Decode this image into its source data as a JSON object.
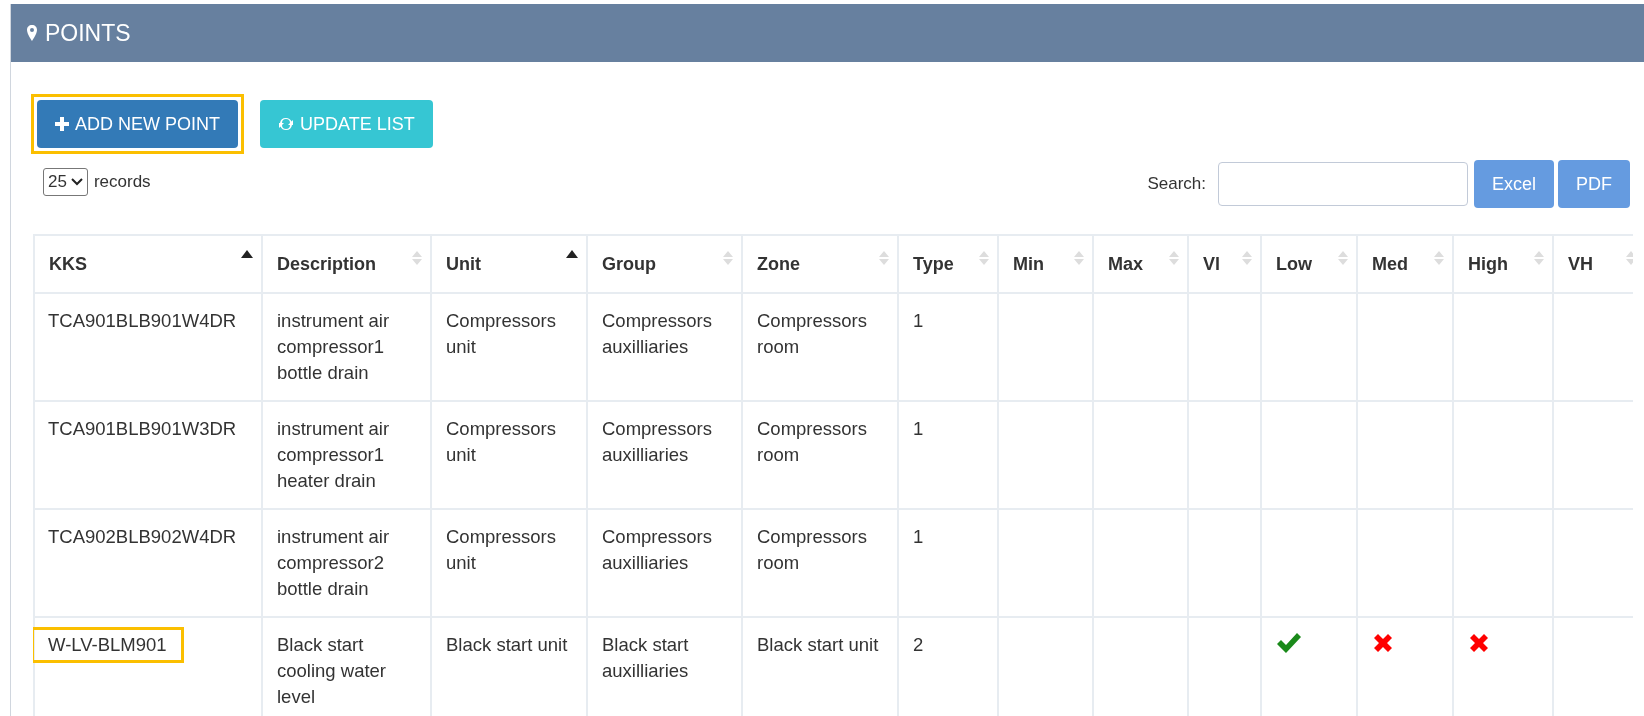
{
  "panel": {
    "title": "POINTS"
  },
  "buttons": [
    {
      "label": "ADD NEW POINT",
      "kind": "add",
      "highlighted": true
    },
    {
      "label": "UPDATE LIST",
      "kind": "refresh",
      "highlighted": false
    }
  ],
  "page_size": {
    "value": "25",
    "label": "records"
  },
  "search": {
    "label": "Search:"
  },
  "exports": [
    "Excel",
    "PDF"
  ],
  "table": {
    "columns": [
      {
        "label": "KKS",
        "sorted": true
      },
      {
        "label": "Description",
        "sorted": false
      },
      {
        "label": "Unit",
        "sorted": true
      },
      {
        "label": "Group",
        "sorted": false
      },
      {
        "label": "Zone",
        "sorted": false
      },
      {
        "label": "Type",
        "sorted": false
      },
      {
        "label": "Min",
        "sorted": false
      },
      {
        "label": "Max",
        "sorted": false
      },
      {
        "label": "Vl",
        "sorted": false
      },
      {
        "label": "Low",
        "sorted": false
      },
      {
        "label": "Med",
        "sorted": false
      },
      {
        "label": "High",
        "sorted": false
      },
      {
        "label": "VH",
        "sorted": false
      }
    ],
    "rows": [
      {
        "highlighted": false,
        "cells": [
          {
            "text": "TCA901BLB901W4DR"
          },
          {
            "text": "instrument air compressor1 bottle drain"
          },
          {
            "text": "Compressors unit"
          },
          {
            "text": "Compressors auxilliaries"
          },
          {
            "text": "Compressors room"
          },
          {
            "text": "1"
          },
          {},
          {},
          {},
          {},
          {},
          {},
          {}
        ]
      },
      {
        "highlighted": false,
        "cells": [
          {
            "text": "TCA901BLB901W3DR"
          },
          {
            "text": "instrument air compressor1 heater drain"
          },
          {
            "text": "Compressors unit"
          },
          {
            "text": "Compressors auxilliaries"
          },
          {
            "text": "Compressors room"
          },
          {
            "text": "1"
          },
          {},
          {},
          {},
          {},
          {},
          {},
          {}
        ]
      },
      {
        "highlighted": false,
        "cells": [
          {
            "text": "TCA902BLB902W4DR"
          },
          {
            "text": "instrument air compressor2 bottle drain"
          },
          {
            "text": "Compressors unit"
          },
          {
            "text": "Compressors auxilliaries"
          },
          {
            "text": "Compressors room"
          },
          {
            "text": "1"
          },
          {},
          {},
          {},
          {},
          {},
          {},
          {}
        ]
      },
      {
        "highlighted": true,
        "cells": [
          {
            "text": "W-LV-BLM901"
          },
          {
            "text": "Black start cooling water level"
          },
          {
            "text": "Black start unit"
          },
          {
            "text": "Black start auxilliaries"
          },
          {
            "text": "Black start unit"
          },
          {
            "text": "2"
          },
          {},
          {},
          {},
          {
            "passed": true
          },
          {
            "passed": false
          },
          {
            "passed": false
          },
          {}
        ]
      }
    ]
  }
}
